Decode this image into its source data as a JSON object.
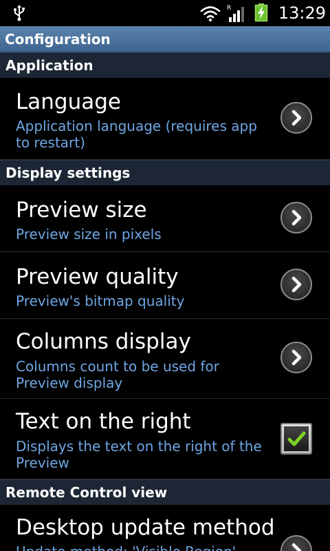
{
  "status_bar": {
    "time": "13:29",
    "signal_label": "R",
    "icons": [
      "usb-icon",
      "wifi-icon",
      "signal-icon",
      "battery-charging-icon"
    ]
  },
  "title_bar": {
    "title": "Configuration"
  },
  "sections": [
    {
      "header": "Application",
      "items": [
        {
          "title": "Language",
          "summary": "Application language (requires app to restart)",
          "widget": "chevron-right-icon"
        }
      ]
    },
    {
      "header": "Display settings",
      "items": [
        {
          "title": "Preview size",
          "summary": "Preview size in pixels",
          "widget": "chevron-right-icon"
        },
        {
          "title": "Preview quality",
          "summary": "Preview's bitmap quality",
          "widget": "chevron-right-icon"
        },
        {
          "title": "Columns display",
          "summary": "Columns count to be used for Preview display",
          "widget": "chevron-right-icon"
        },
        {
          "title": "Text on the right",
          "summary": "Displays the text on the right of the Preview",
          "widget": "checkbox",
          "checked": true
        }
      ]
    },
    {
      "header": "Remote Control view",
      "items": [
        {
          "title": "Desktop update method",
          "summary": "Update method: 'Visible Region'",
          "widget": "chevron-right-icon"
        }
      ]
    }
  ],
  "colors": {
    "title_bar": "#4a739e",
    "category_header": "#1c2634",
    "summary_text": "#6fa6e3",
    "check_mark": "#7ed321"
  }
}
